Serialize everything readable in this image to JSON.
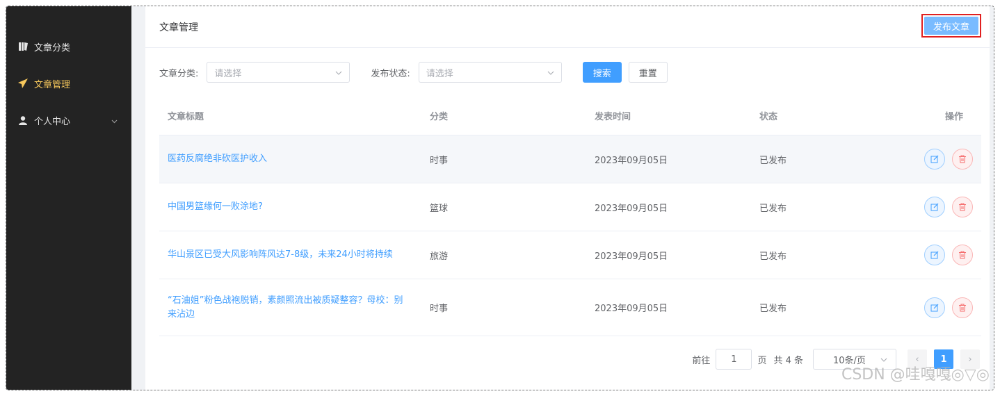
{
  "sidebar": {
    "items": [
      {
        "label": "文章分类",
        "icon": "book-icon"
      },
      {
        "label": "文章管理",
        "icon": "paper-plane-icon",
        "active": true
      },
      {
        "label": "个人中心",
        "icon": "user-icon",
        "has_submenu": true
      }
    ]
  },
  "header": {
    "title": "文章管理",
    "publish_label": "发布文章"
  },
  "filters": {
    "category_label": "文章分类:",
    "category_placeholder": "请选择",
    "status_label": "发布状态:",
    "status_placeholder": "请选择",
    "search_label": "搜索",
    "reset_label": "重置"
  },
  "table": {
    "columns": [
      "文章标题",
      "分类",
      "发表时间",
      "状态",
      "操作"
    ],
    "rows": [
      {
        "title": "医药反腐绝非砍医护收入",
        "category": "时事",
        "date": "2023年09月05日",
        "status": "已发布"
      },
      {
        "title": "中国男篮缘何一败涂地?",
        "category": "篮球",
        "date": "2023年09月05日",
        "status": "已发布"
      },
      {
        "title": "华山景区已受大风影响阵风达7-8级，未来24小时将持续",
        "category": "旅游",
        "date": "2023年09月05日",
        "status": "已发布"
      },
      {
        "title": "“石油姐”粉色战袍脱销，素颜照流出被质疑整容？母校：别来沾边",
        "category": "时事",
        "date": "2023年09月05日",
        "status": "已发布"
      }
    ]
  },
  "pagination": {
    "goto_label": "前往",
    "page_input": "1",
    "page_unit": "页",
    "total_text": "共 4 条",
    "page_size": "10条/页",
    "current_page": "1",
    "prev": "‹",
    "next": "›"
  },
  "watermark": "CSDN @哇嘎嘎◎▽◎",
  "colors": {
    "accent": "#409eff",
    "sidebar_bg": "#232323",
    "active_menu": "#f7c85c",
    "danger": "#f56c6c"
  }
}
